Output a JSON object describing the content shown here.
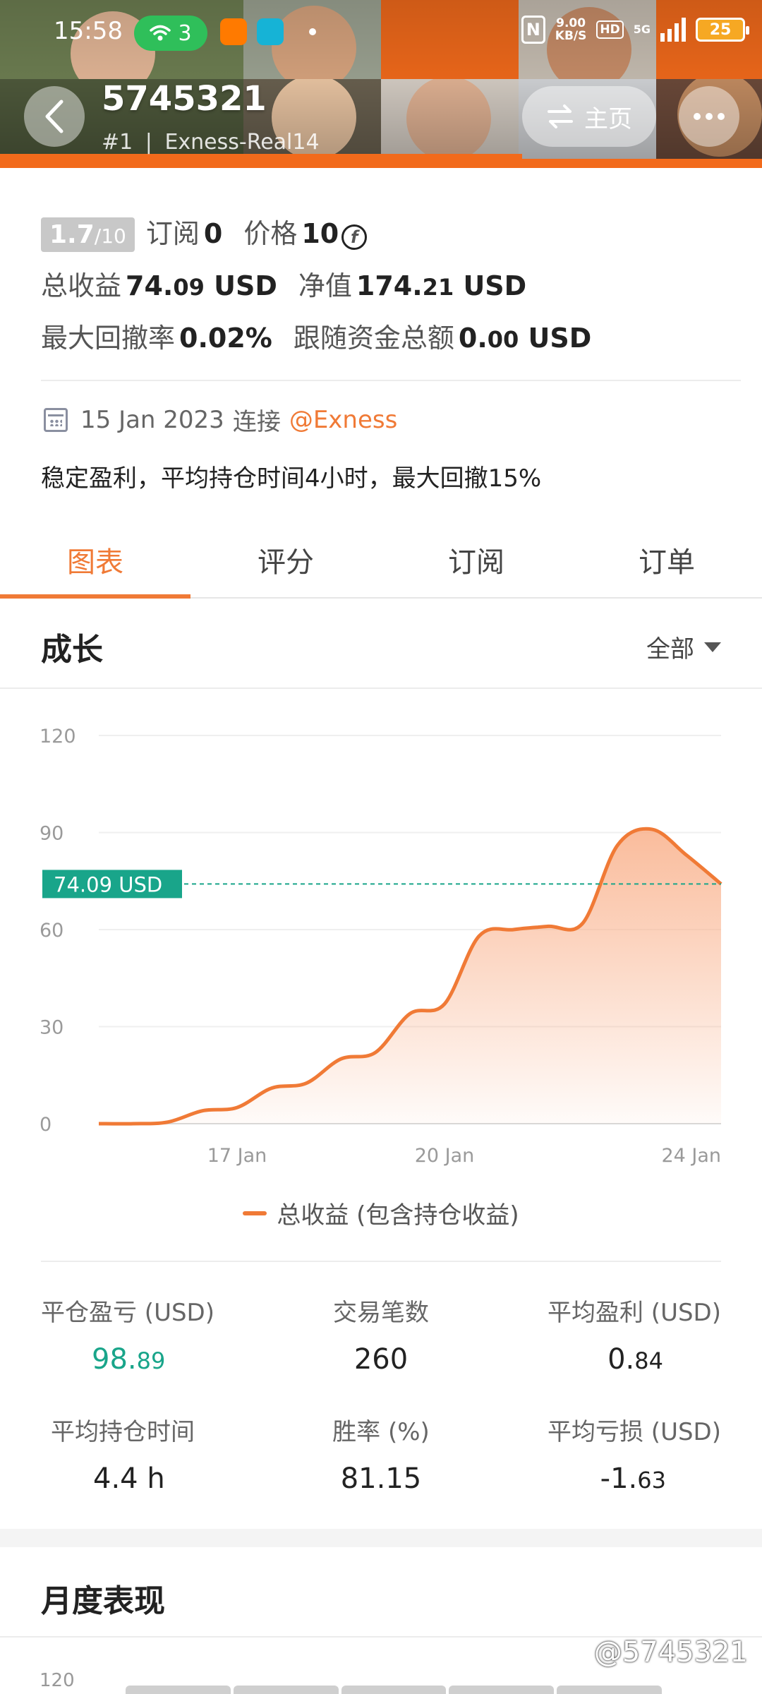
{
  "status_bar": {
    "time": "15:58",
    "wifi_count": "3",
    "net_speed_value": "9.00",
    "net_speed_unit": "KB/S",
    "hd_label": "HD",
    "signal_label": "5G",
    "battery": "25"
  },
  "header": {
    "account_id": "5745321",
    "rank": "#1",
    "server": "Exness-Real14",
    "home_label": "主页"
  },
  "info": {
    "rating": "1.7",
    "rating_max": "/10",
    "subscribe_label": "订阅",
    "subscribe_value": "0",
    "price_label": "价格",
    "price_value": "10",
    "price_coin_symbol": "f",
    "total_profit_label": "总收益",
    "total_profit_int": "74.",
    "total_profit_dec": "09",
    "total_profit_unit": "USD",
    "equity_label": "净值",
    "equity_int": "174.",
    "equity_dec": "21",
    "equity_unit": "USD",
    "max_drawdown_label": "最大回撤率",
    "max_drawdown_value": "0.02%",
    "follow_funds_label": "跟随资金总额",
    "follow_funds_int": "0.",
    "follow_funds_dec": "00",
    "follow_funds_unit": "USD",
    "connect_date": "15 Jan 2023",
    "connect_label": "连接",
    "broker": "@Exness",
    "description": "稳定盈利，平均持仓时间4小时，最大回撤15%"
  },
  "tabs": [
    {
      "label": "图表",
      "active": true
    },
    {
      "label": "评分",
      "active": false
    },
    {
      "label": "订阅",
      "active": false
    },
    {
      "label": "订单",
      "active": false
    }
  ],
  "growth": {
    "title": "成长",
    "filter_label": "全部"
  },
  "chart_data": {
    "type": "area",
    "ylim": [
      0,
      120
    ],
    "yticks": [
      0,
      30,
      60,
      90,
      120
    ],
    "xtick_labels": [
      "17 Jan",
      "20 Jan",
      "24 Jan"
    ],
    "x": [
      "15 Jan",
      "15.5 Jan",
      "16 Jan",
      "16.5 Jan",
      "17 Jan",
      "17.5 Jan",
      "18 Jan",
      "18.5 Jan",
      "19 Jan",
      "19.5 Jan",
      "20 Jan",
      "20.5 Jan",
      "21 Jan",
      "21.5 Jan",
      "22 Jan",
      "22.5 Jan",
      "23 Jan",
      "23.5 Jan",
      "24 Jan"
    ],
    "series": [
      {
        "name": "总收益 (包含持仓收益)",
        "values": [
          0,
          0,
          0.5,
          4,
          5,
          11,
          12.5,
          20,
          22,
          34,
          37,
          58,
          60,
          61,
          62,
          86,
          91,
          83,
          74.09
        ]
      }
    ],
    "reference_label": "74.09 USD",
    "reference_value": 74.09,
    "colors": {
      "line": "#f07a36",
      "area_top": "#f9b08a",
      "reference": "#19a58a"
    }
  },
  "stats": [
    {
      "label": "平仓盈亏 (USD)",
      "int": "98.",
      "dec": "89",
      "color": "#19a58a"
    },
    {
      "label": "交易笔数",
      "int": "260",
      "dec": ""
    },
    {
      "label": "平均盈利 (USD)",
      "int": "0.",
      "dec": "84"
    },
    {
      "label": "平均持仓时间",
      "int": "4.4 h",
      "dec": ""
    },
    {
      "label": "胜率 (%)",
      "int": "81.15",
      "dec": ""
    },
    {
      "label": "平均亏损 (USD)",
      "int": "-1.",
      "dec": "63"
    }
  ],
  "monthly": {
    "title": "月度表现",
    "first_tick": "120"
  },
  "watermark": "@5745321",
  "colors": {
    "accent": "#f07a36",
    "positive": "#19a58a",
    "banner": "#f26a1b"
  }
}
